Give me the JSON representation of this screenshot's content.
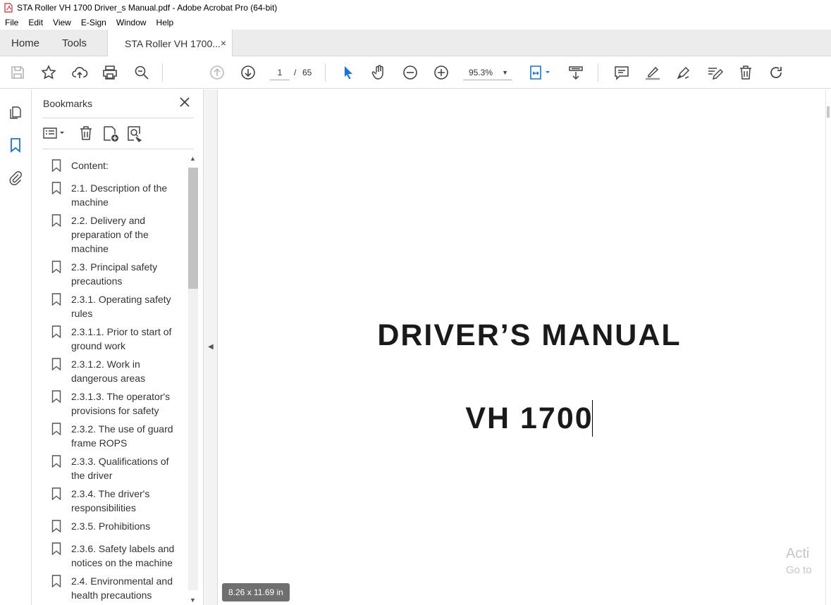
{
  "window": {
    "title": "STA Roller VH 1700 Driver_s Manual.pdf - Adobe Acrobat Pro (64-bit)"
  },
  "menu": [
    "File",
    "Edit",
    "View",
    "E-Sign",
    "Window",
    "Help"
  ],
  "tabs": {
    "home": "Home",
    "tools": "Tools",
    "doc": "STA Roller VH 1700...",
    "close": "×"
  },
  "toolbar": {
    "page_current": "1",
    "page_sep": "/",
    "page_total": "65",
    "zoom": "95.3%"
  },
  "bookmarks": {
    "title": "Bookmarks",
    "items": [
      {
        "label": "Content:"
      },
      {
        "label": "2.1. Description of the machine"
      },
      {
        "label": "2.2. Delivery and preparation of the machine"
      },
      {
        "label": "2.3. Principal safety precautions"
      },
      {
        "label": "2.3.1. Operating safety rules"
      },
      {
        "label": "2.3.1.1. Prior to start of ground work"
      },
      {
        "label": "2.3.1.2. Work in dangerous areas"
      },
      {
        "label": "2.3.1.3. The operator's provisions for safety"
      },
      {
        "label": "2.3.2. The use of guard frame ROPS"
      },
      {
        "label": "2.3.3. Qualifications of the driver"
      },
      {
        "label": "2.3.4. The driver's responsibilities"
      },
      {
        "label": "2.3.5. Prohibitions"
      },
      {
        "label": "2.3.6. Safety labels and notices on the machine"
      },
      {
        "label": "2.4. Environmental and health precautions"
      }
    ]
  },
  "document": {
    "title": "DRIVER’S MANUAL",
    "subtitle": "VH 1700",
    "page_size": "8.26 x 11.69 in",
    "watermark_line1": "Acti",
    "watermark_line2": "Go to"
  },
  "colors": {
    "accent": "#1473e6",
    "pdf_red": "#d7282f"
  }
}
